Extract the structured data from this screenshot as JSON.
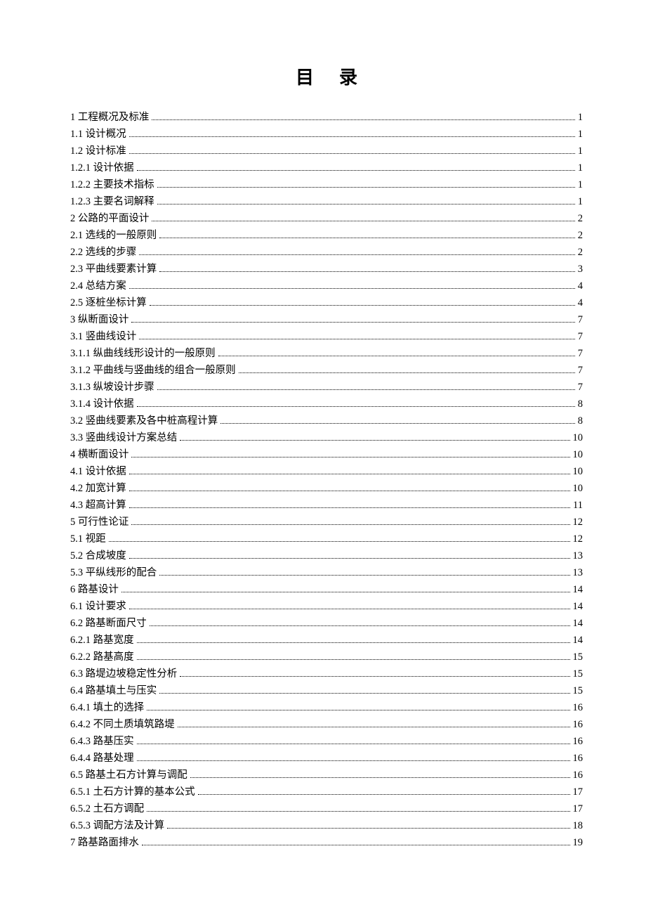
{
  "title": "目录",
  "entries": [
    {
      "label": "1  工程概况及标准",
      "page": "1"
    },
    {
      "label": "1.1 设计概况",
      "page": "1"
    },
    {
      "label": "1.2  设计标准",
      "page": "1"
    },
    {
      "label": "1.2.1 设计依据",
      "page": "1"
    },
    {
      "label": "1.2.2 主要技术指标",
      "page": "1"
    },
    {
      "label": "1.2.3 主要名词解释",
      "page": "1"
    },
    {
      "label": "2 公路的平面设计",
      "page": "2"
    },
    {
      "label": "2.1 选线的一般原则",
      "page": "2"
    },
    {
      "label": "2.2 选线的步骤",
      "page": "2"
    },
    {
      "label": "2.3 平曲线要素计算",
      "page": "3"
    },
    {
      "label": "2.4 总结方案",
      "page": "4"
    },
    {
      "label": "2.5 逐桩坐标计算",
      "page": "4"
    },
    {
      "label": "3 纵断面设计",
      "page": "7"
    },
    {
      "label": "3.1 竖曲线设计",
      "page": "7"
    },
    {
      "label": "3.1.1 纵曲线线形设计的一般原则",
      "page": "7"
    },
    {
      "label": "3.1.2 平曲线与竖曲线的组合一般原则",
      "page": "7"
    },
    {
      "label": "3.1.3 纵坡设计步骤",
      "page": "7"
    },
    {
      "label": "3.1.4 设计依据",
      "page": "8"
    },
    {
      "label": "3.2 竖曲线要素及各中桩高程计算",
      "page": "8"
    },
    {
      "label": "3.3 竖曲线设计方案总结",
      "page": "10"
    },
    {
      "label": "4 横断面设计",
      "page": "10"
    },
    {
      "label": "4.1 设计依据",
      "page": "10"
    },
    {
      "label": "4.2 加宽计算",
      "page": "10"
    },
    {
      "label": "4.3 超高计算",
      "page": "11"
    },
    {
      "label": "5 可行性论证",
      "page": "12"
    },
    {
      "label": "5.1 视距",
      "page": "12"
    },
    {
      "label": "5.2 合成坡度",
      "page": "13"
    },
    {
      "label": "5.3 平纵线形的配合",
      "page": "13"
    },
    {
      "label": "6 路基设计",
      "page": "14"
    },
    {
      "label": "6.1 设计要求",
      "page": "14"
    },
    {
      "label": "6.2 路基断面尺寸",
      "page": "14"
    },
    {
      "label": "6.2.1 路基宽度",
      "page": "14"
    },
    {
      "label": "6.2.2 路基高度",
      "page": "15"
    },
    {
      "label": "6.3 路堤边坡稳定性分析",
      "page": "15"
    },
    {
      "label": "6.4 路基填土与压实",
      "page": "15"
    },
    {
      "label": "6.4.1 填土的选择",
      "page": "16"
    },
    {
      "label": "6.4.2 不同土质填筑路堤",
      "page": "16"
    },
    {
      "label": "6.4.3 路基压实",
      "page": "16"
    },
    {
      "label": "6.4.4 路基处理",
      "page": "16"
    },
    {
      "label": "6.5 路基土石方计算与调配",
      "page": "16"
    },
    {
      "label": "6.5.1 土石方计算的基本公式",
      "page": "17"
    },
    {
      "label": "6.5.2 土石方调配",
      "page": "17"
    },
    {
      "label": "6.5.3 调配方法及计算",
      "page": "18"
    },
    {
      "label": "7 路基路面排水",
      "page": "19"
    }
  ]
}
